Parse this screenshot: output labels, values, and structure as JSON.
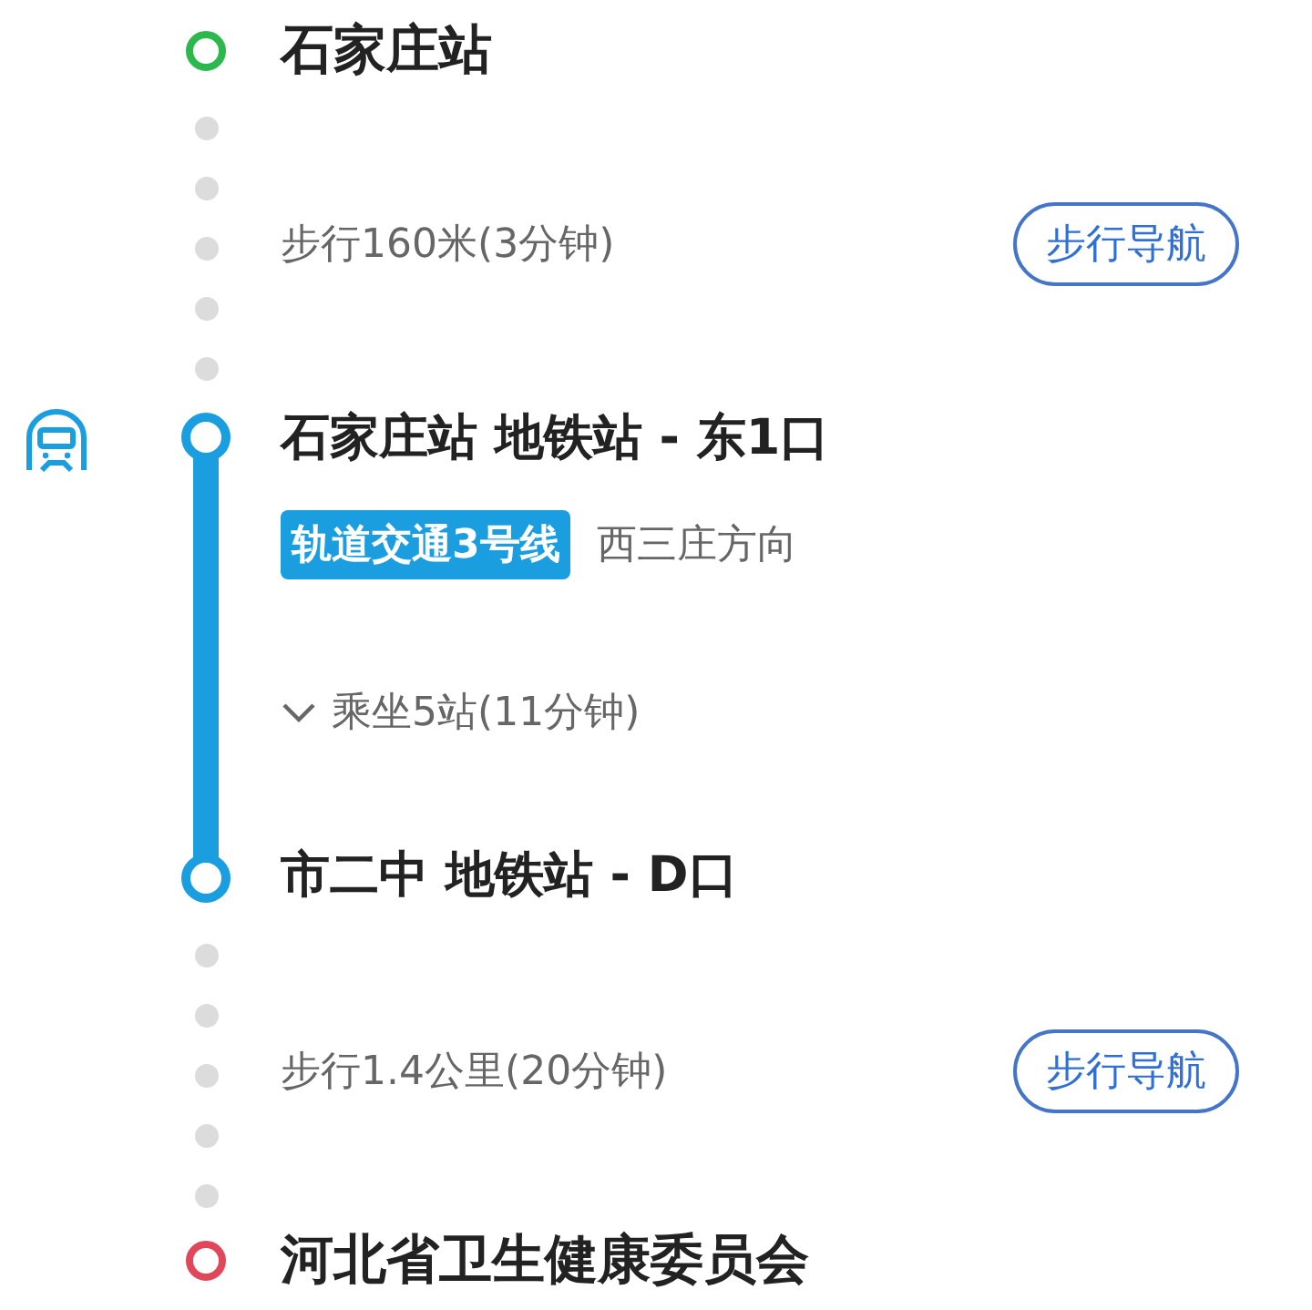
{
  "route": [
    {
      "kind": "endpoint",
      "name": "石家庄站",
      "color": "#2db84d"
    },
    {
      "kind": "walk",
      "text": "步行160米(3分钟)",
      "button": "步行导航"
    },
    {
      "kind": "transit",
      "board": "石家庄站 地铁站 - 东1口",
      "line": "轨道交通3号线",
      "direction": "西三庄方向",
      "ride": "乘坐5站(11分钟)",
      "alight": "市二中 地铁站 - D口",
      "color": "#1a9ee0"
    },
    {
      "kind": "walk",
      "text": "步行1.4公里(20分钟)",
      "button": "步行导航"
    },
    {
      "kind": "endpoint",
      "name": "河北省卫生健康委员会",
      "color": "#e0485a"
    }
  ]
}
